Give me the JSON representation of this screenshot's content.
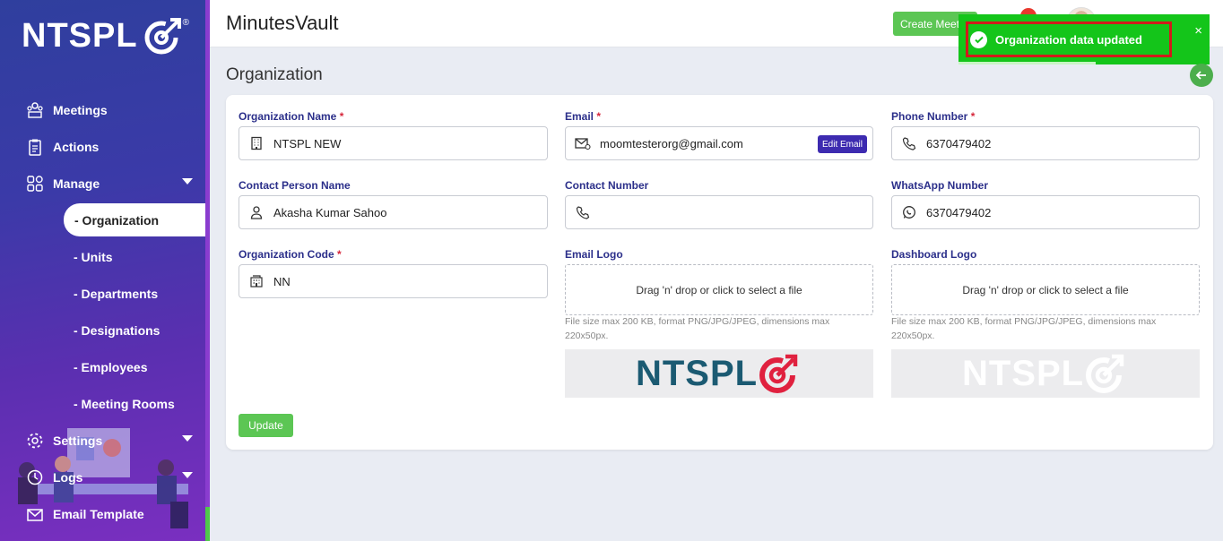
{
  "brand": {
    "logo_text": "NTSPL",
    "logo_reg": "®"
  },
  "sidebar": {
    "items": [
      {
        "label": "Meetings",
        "icon": "meetings-icon"
      },
      {
        "label": "Actions",
        "icon": "clipboard-icon"
      },
      {
        "label": "Manage",
        "icon": "grid-icon"
      },
      {
        "label": "Settings",
        "icon": "gear-icon"
      },
      {
        "label": "Logs",
        "icon": "clock-icon"
      },
      {
        "label": "Email Template",
        "icon": "mail-icon"
      }
    ],
    "sub_items": [
      {
        "label": "- Organization"
      },
      {
        "label": "- Units"
      },
      {
        "label": "- Departments"
      },
      {
        "label": "- Designations"
      },
      {
        "label": "- Employees"
      },
      {
        "label": "- Meeting Rooms"
      }
    ]
  },
  "header": {
    "app_title": "MinutesVault",
    "create_button": "Create Meeting",
    "notification_count": ""
  },
  "toast": {
    "message": "Organization data updated",
    "close": "×"
  },
  "page": {
    "title": "Organization"
  },
  "form": {
    "org_name": {
      "label": "Organization Name",
      "required": "*",
      "value": "NTSPL NEW"
    },
    "email": {
      "label": "Email",
      "required": "*",
      "value": "moomtesterorg@gmail.com",
      "edit_label": "Edit Email"
    },
    "phone": {
      "label": "Phone Number",
      "required": "*",
      "value": "6370479402"
    },
    "contact_person": {
      "label": "Contact Person Name",
      "value": "Akasha Kumar Sahoo"
    },
    "contact_number": {
      "label": "Contact Number",
      "value": ""
    },
    "whatsapp": {
      "label": "WhatsApp Number",
      "value": "6370479402"
    },
    "org_code": {
      "label": "Organization Code",
      "required": "*",
      "value": "NN"
    },
    "email_logo": {
      "label": "Email Logo",
      "drop_text": "Drag 'n' drop or click to select a file",
      "hint": "File size max 200 KB, format PNG/JPG/JPEG, dimensions max 220x50px.",
      "preview_text": "NTSPL"
    },
    "dashboard_logo": {
      "label": "Dashboard Logo",
      "drop_text": "Drag 'n' drop or click to select a file",
      "hint": "File size max 200 KB, format PNG/JPG/JPEG, dimensions max 220x50px.",
      "preview_text": "NTSPL"
    },
    "update_button": "Update"
  },
  "colors": {
    "accent_green": "#5cc654",
    "toast_green": "#14c51a",
    "label_blue": "#2b2f8a",
    "edit_purple": "#3d2bb0",
    "logo_teal": "#1b5a72",
    "logo_red": "#e0213f"
  }
}
